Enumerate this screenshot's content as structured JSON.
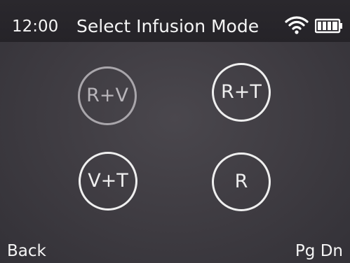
{
  "status_bar": {
    "time": "12:00",
    "title": "Select Infusion Mode",
    "wifi_icon": "wifi-icon",
    "battery_icon": "battery-icon"
  },
  "modes": [
    {
      "label": "R+V",
      "state": "dimmed"
    },
    {
      "label": "R+T",
      "state": "active"
    },
    {
      "label": "V+T",
      "state": "active"
    },
    {
      "label": "R",
      "state": "active"
    }
  ],
  "softkeys": {
    "left": "Back",
    "right": "Pg Dn"
  },
  "colors": {
    "background": "#403d43",
    "header": "#252328",
    "text": "#f5f5f5",
    "ring_active": "#efefef",
    "ring_dimmed": "#a9a6ab"
  }
}
